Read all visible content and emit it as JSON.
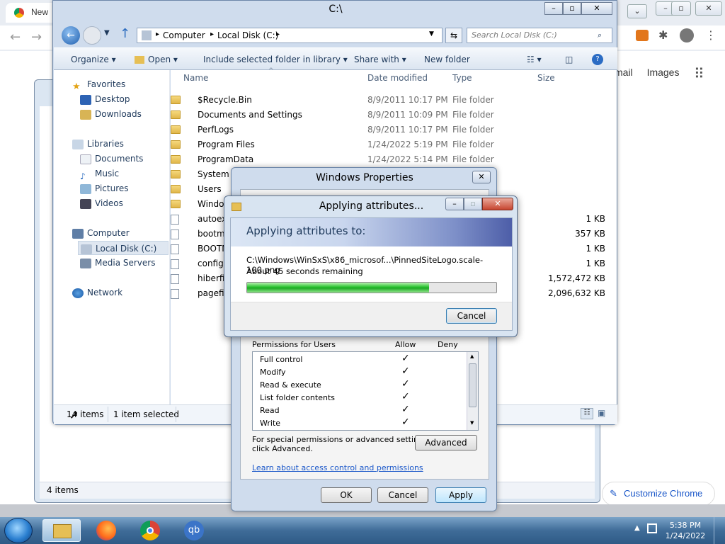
{
  "chrome": {
    "tab_title": "New",
    "links": [
      "mail",
      "Images"
    ],
    "customize_label": "Customize Chrome"
  },
  "back_window": {
    "status_items": "4 items"
  },
  "explorer": {
    "title": "C:\\",
    "breadcrumb": [
      "Computer",
      "Local Disk (C:)"
    ],
    "search_placeholder": "Search Local Disk (C:)",
    "toolbar": {
      "organize": "Organize",
      "open": "Open",
      "include": "Include selected folder in library",
      "share": "Share with",
      "new_folder": "New folder"
    },
    "nav": {
      "favorites": "Favorites",
      "desktop": "Desktop",
      "downloads": "Downloads",
      "libraries": "Libraries",
      "documents": "Documents",
      "music": "Music",
      "pictures": "Pictures",
      "videos": "Videos",
      "computer": "Computer",
      "local_disk": "Local Disk (C:)",
      "media_servers": "Media Servers",
      "network": "Network"
    },
    "columns": {
      "name": "Name",
      "date": "Date modified",
      "type": "Type",
      "size": "Size"
    },
    "rows": [
      {
        "name": "$Recycle.Bin",
        "date": "8/9/2011 10:17 PM",
        "type": "File folder",
        "size": ""
      },
      {
        "name": "Documents and Settings",
        "date": "8/9/2011 10:09 PM",
        "type": "File folder",
        "size": ""
      },
      {
        "name": "PerfLogs",
        "date": "8/9/2011 10:17 PM",
        "type": "File folder",
        "size": ""
      },
      {
        "name": "Program Files",
        "date": "1/24/2022 5:19 PM",
        "type": "File folder",
        "size": ""
      },
      {
        "name": "ProgramData",
        "date": "1/24/2022 5:14 PM",
        "type": "File folder",
        "size": ""
      },
      {
        "name": "System V",
        "date": "",
        "type": "",
        "size": ""
      },
      {
        "name": "Users",
        "date": "",
        "type": "",
        "size": ""
      },
      {
        "name": "Windo",
        "date": "",
        "type": "",
        "size": ""
      },
      {
        "name": "autoex",
        "date": "",
        "type": "le",
        "size": "1 KB"
      },
      {
        "name": "bootm",
        "date": "",
        "type": "",
        "size": "357 KB"
      },
      {
        "name": "BOOTN",
        "date": "",
        "type": "",
        "size": "1 KB"
      },
      {
        "name": "config.",
        "date": "",
        "type": "",
        "size": "1 KB"
      },
      {
        "name": "hiberfil",
        "date": "",
        "type": "",
        "size": "1,572,472 KB"
      },
      {
        "name": "pagefil",
        "date": "",
        "type": "",
        "size": "2,096,632 KB"
      }
    ],
    "status_count": "14 items",
    "status_selected": "1 item selected"
  },
  "properties": {
    "title": "Windows Properties",
    "perm_header": "Permissions for Users",
    "allow": "Allow",
    "deny": "Deny",
    "permissions": [
      {
        "name": "Full control",
        "allow": "✓"
      },
      {
        "name": "Modify",
        "allow": "✓"
      },
      {
        "name": "Read & execute",
        "allow": "✓"
      },
      {
        "name": "List folder contents",
        "allow": "✓"
      },
      {
        "name": "Read",
        "allow": "✓"
      },
      {
        "name": "Write",
        "allow": "✓"
      }
    ],
    "special_text_1": "For special permissions or advanced settings,",
    "special_text_2": "click Advanced.",
    "advanced": "Advanced",
    "learn_link": "Learn about access control and permissions",
    "ok": "OK",
    "cancel": "Cancel",
    "apply": "Apply"
  },
  "applying": {
    "title": "Applying attributes...",
    "heading": "Applying attributes to:",
    "path": "C:\\Windows\\WinSxS\\x86_microsof...\\PinnedSiteLogo.scale-100.png",
    "time": "About 45 seconds remaining",
    "progress": 0.73,
    "cancel": "Cancel"
  },
  "taskbar": {
    "time": "5:38 PM",
    "date": "1/24/2022"
  },
  "colors": {
    "accent": "#1e395b",
    "progress": "#27c22f",
    "link": "#1a57c9"
  }
}
